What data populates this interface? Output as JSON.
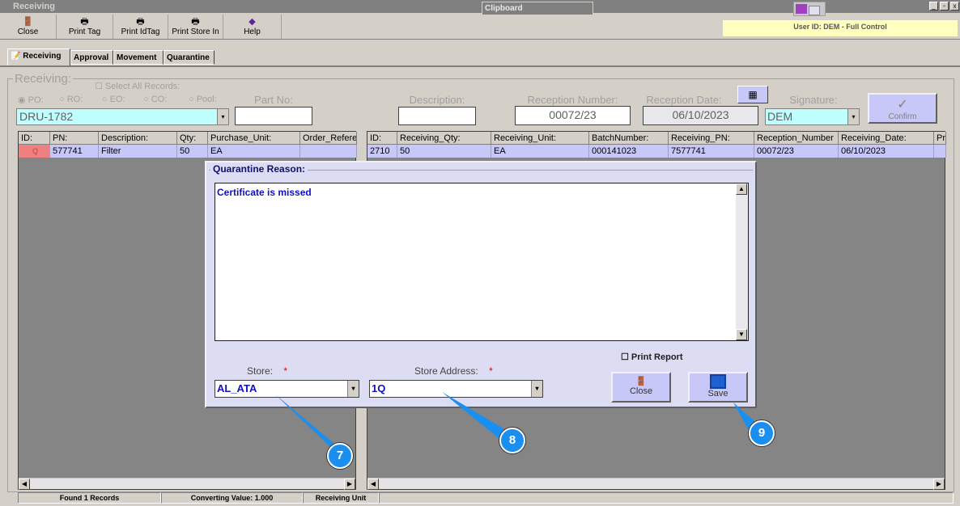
{
  "window": {
    "title": "Receiving",
    "clipboard": "Clipboard",
    "min": "_",
    "restore": "▫",
    "close": "x"
  },
  "toolbar": [
    {
      "label": "Close",
      "icon": "door-icon"
    },
    {
      "label": "Print Tag",
      "icon": "printer-icon"
    },
    {
      "label": "Print IdTag",
      "icon": "printer-icon"
    },
    {
      "label": "Print Store In",
      "icon": "printer-icon"
    },
    {
      "label": "Help",
      "icon": "help-book-icon"
    }
  ],
  "user_id": "User ID: DEM - Full Control",
  "tabs": [
    "Receiving",
    "Approval",
    "Movement",
    "Quarantine"
  ],
  "form": {
    "group_title": "Receiving:",
    "select_all": "Select All Records:",
    "radios": [
      "PO:",
      "RO:",
      "EO:",
      "CO:",
      "Pool:"
    ],
    "order_value": "DRU-1782",
    "part_no_label": "Part No:",
    "part_no_value": "",
    "description_label": "Description:",
    "description_value": "",
    "reception_number_label": "Reception Number:",
    "reception_number_value": "00072/23",
    "reception_date_label": "Reception Date:",
    "reception_date_value": "06/10/2023",
    "signature_label": "Signature:",
    "signature_value": "DEM",
    "confirm_label": "Confirm"
  },
  "left_grid": {
    "headers": [
      "ID:",
      "PN:",
      "Description:",
      "Qty:",
      "Purchase_Unit:",
      "Order_Refere"
    ],
    "rows": [
      [
        "Q",
        "577741",
        "Filter",
        "50",
        "EA",
        ""
      ]
    ]
  },
  "right_grid": {
    "headers": [
      "ID:",
      "Receiving_Qty:",
      "Receiving_Unit:",
      "BatchNumber:",
      "Receiving_PN:",
      "Reception_Number",
      "Receiving_Date:",
      "Pr"
    ],
    "rows": [
      [
        "2710",
        "50",
        "EA",
        "000141023",
        "7577741",
        "00072/23",
        "06/10/2023",
        ""
      ]
    ]
  },
  "status": [
    "Found 1 Records",
    "Converting Value: 1.000",
    "Receiving Unit",
    ""
  ],
  "dialog": {
    "title": "Quarantine Reason:",
    "reason": "Certificate is missed",
    "print_report": "Print Report",
    "store_label": "Store:",
    "store_value": "AL_ATA",
    "address_label": "Store Address:",
    "address_value": "1Q",
    "required": "*",
    "close_label": "Close",
    "save_label": "Save"
  },
  "callouts": [
    "7",
    "8",
    "9"
  ],
  "colors": {
    "callout": "#1a8ff0",
    "selected_row": "#c8c8f8",
    "dialog_bg": "#dcdcf2"
  }
}
